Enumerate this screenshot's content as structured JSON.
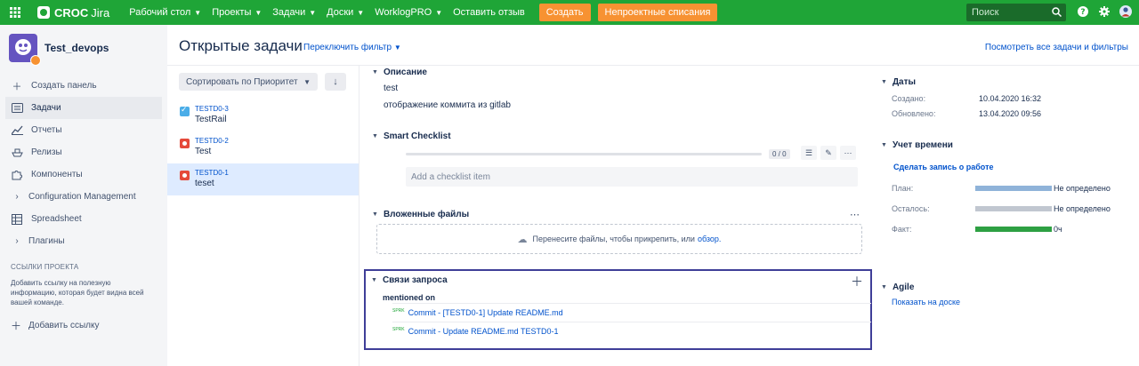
{
  "topbar": {
    "logo_brand": "CROC",
    "logo_product": "Jira",
    "nav": [
      "Рабочий стол",
      "Проекты",
      "Задачи",
      "Доски",
      "WorklogPRO",
      "Оставить отзыв"
    ],
    "create_label": "Создать",
    "writeoff_label": "Непроектные списания",
    "search_placeholder": "Поиск",
    "accent": "#1fa537",
    "button_color": "#f79232"
  },
  "sidebar": {
    "project_name": "Test_devops",
    "items": [
      {
        "icon": "plus-icon",
        "label": "Создать панель"
      },
      {
        "icon": "backlog-icon",
        "label": "Задачи"
      },
      {
        "icon": "chart-icon",
        "label": "Отчеты"
      },
      {
        "icon": "ship-icon",
        "label": "Релизы"
      },
      {
        "icon": "puzzle-icon",
        "label": "Компоненты"
      },
      {
        "icon": "chevron-right-icon",
        "label": "Configuration Management"
      },
      {
        "icon": "table-icon",
        "label": "Spreadsheet"
      },
      {
        "icon": "chevron-right-icon",
        "label": "Плагины"
      }
    ],
    "section_title": "ССЫЛКИ ПРОЕКТА",
    "section_note": "Добавить ссылку на полезную информацию, которая будет видна всей вашей команде.",
    "add_link": "Добавить ссылку"
  },
  "header": {
    "title": "Открытые задачи",
    "switch_filter": "Переключить фильтр",
    "view_all": "Посмотреть все задачи и фильтры"
  },
  "list": {
    "sort_label": "Сортировать по Приоритет",
    "issues": [
      {
        "key": "TESTD0-3",
        "summary": "TestRail",
        "type": "task"
      },
      {
        "key": "TESTD0-2",
        "summary": "Test",
        "type": "bug"
      },
      {
        "key": "TESTD0-1",
        "summary": "teset",
        "type": "bug"
      }
    ]
  },
  "detail": {
    "description_title": "Описание",
    "description_lines": [
      "test",
      "отображение коммита из gitlab"
    ],
    "checklist_title": "Smart Checklist",
    "checklist_count": "0 / 0",
    "checklist_placeholder": "Add a checklist item",
    "attachments_title": "Вложенные файлы",
    "drop_text": "Перенесите файлы, чтобы прикрепить, или",
    "drop_link": "обзор.",
    "links_title": "Связи запроса",
    "mentioned_on": "mentioned on",
    "links": [
      {
        "prefix": "SPRK",
        "text": "Commit - [TESTD0-1] Update README.md"
      },
      {
        "prefix": "SPRK",
        "text": "Commit - Update README.md TESTD0-1"
      }
    ]
  },
  "right": {
    "dates_title": "Даты",
    "created_label": "Создано:",
    "created_value": "10.04.2020 16:32",
    "updated_label": "Обновлено:",
    "updated_value": "13.04.2020 09:56",
    "time_title": "Учет времени",
    "log_work": "Сделать запись о работе",
    "plan_label": "План:",
    "plan_value": "Не определено",
    "remaining_label": "Осталось:",
    "remaining_value": "Не определено",
    "fact_label": "Факт:",
    "fact_value": "0ч",
    "agile_title": "Agile",
    "agile_link": "Показать на доске"
  }
}
